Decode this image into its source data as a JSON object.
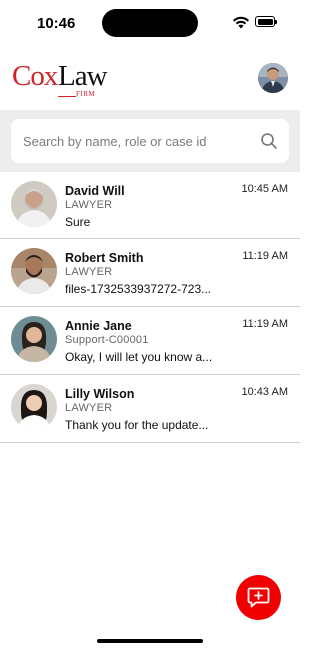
{
  "status": {
    "time": "10:46"
  },
  "header": {
    "logo_primary": "Cox",
    "logo_secondary": "Law",
    "logo_tagline": "FIRM"
  },
  "search": {
    "placeholder": "Search by name, role or case id",
    "value": ""
  },
  "conversations": [
    {
      "name": "David Will",
      "role": "LAWYER",
      "message": "Sure",
      "time": "10:45 AM"
    },
    {
      "name": "Robert Smith",
      "role": "LAWYER",
      "message": "files-1732533937272-723...",
      "time": "11:19 AM"
    },
    {
      "name": "Annie Jane",
      "role": "Support-C00001",
      "message": "Okay, I will let you know a...",
      "time": "11:19 AM"
    },
    {
      "name": "Lilly Wilson",
      "role": "LAWYER",
      "message": "Thank you for the update...",
      "time": "10:43 AM"
    }
  ],
  "colors": {
    "brand_red": "#d2232a",
    "fab": "#f00000",
    "search_band": "#ededed",
    "divider": "#cfcfcf"
  },
  "icons": {
    "search": "search-icon",
    "new_chat": "new-message-icon"
  }
}
